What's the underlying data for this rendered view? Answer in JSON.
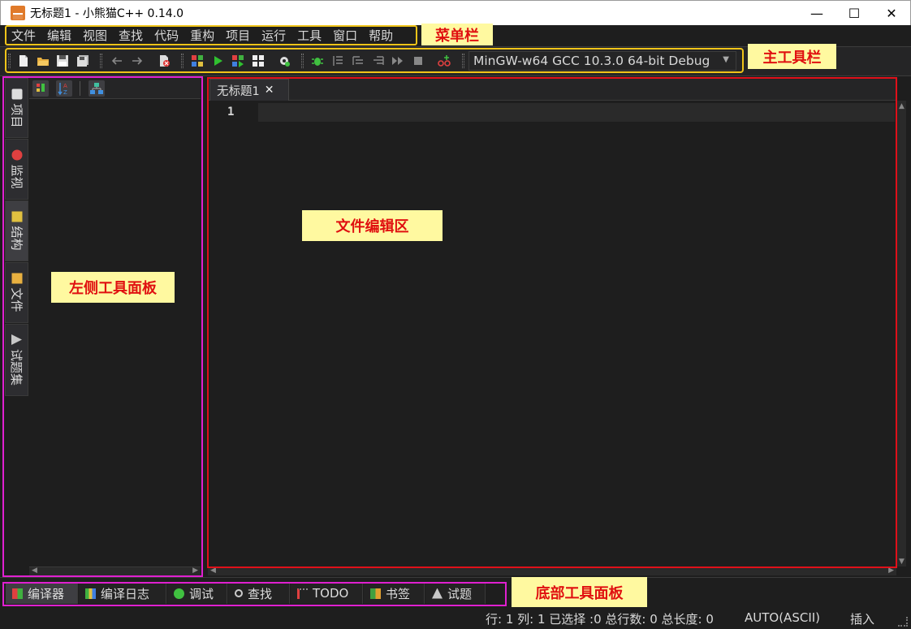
{
  "window": {
    "title": "无标题1 - 小熊猫C++ 0.14.0",
    "minimize": "—",
    "maximize": "☐",
    "close": "✕"
  },
  "menu": {
    "items": [
      "文件",
      "编辑",
      "视图",
      "查找",
      "代码",
      "重构",
      "项目",
      "运行",
      "工具",
      "窗口",
      "帮助"
    ]
  },
  "toolbar": {
    "compiler": "MinGW-w64 GCC 10.3.0 64-bit Debug",
    "dropdown_arrow": "▼"
  },
  "left_panel": {
    "tabs": [
      "项目",
      "监视",
      "结构",
      "文件",
      "试题集"
    ],
    "active_tab": "结构"
  },
  "editor": {
    "tab_label": "无标题1",
    "tab_close": "✕",
    "line_number": "1"
  },
  "bottom_panel": {
    "tabs": [
      "编译器",
      "编译日志",
      "调试",
      "查找",
      "TODO",
      "书签",
      "试题"
    ],
    "active_tab": "编译器"
  },
  "status": {
    "position": "行: 1 列: 1 已选择 :0 总行数: 0 总长度: 0",
    "encoding": "AUTO(ASCII)",
    "mode": "插入"
  },
  "annotations": {
    "menubar": "菜单栏",
    "toolbar": "主工具栏",
    "editor": "文件编辑区",
    "left_panel": "左侧工具面板",
    "bottom_panel": "底部工具面板"
  },
  "colors": {
    "background": "#1e1e1e",
    "menu_frame": "#f0c419",
    "panel_frame": "#e020d0",
    "editor_frame": "#e0101a",
    "callout_bg": "#fff9a0",
    "callout_text": "#e01010"
  }
}
